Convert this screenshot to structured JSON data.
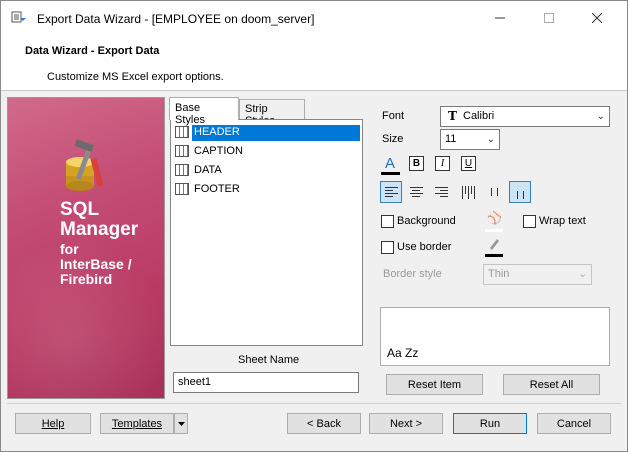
{
  "window": {
    "title": "Export Data Wizard - [EMPLOYEE on doom_server]"
  },
  "header": {
    "title": "Data Wizard - Export Data",
    "subtitle": "Customize MS Excel export options."
  },
  "banner": {
    "line1": "SQL",
    "line2": "Manager",
    "line3": "for",
    "line4": "InterBase /",
    "line5": "Firebird",
    "icon": "database-tools-icon"
  },
  "tabs": [
    {
      "label": "Base Styles",
      "active": true
    },
    {
      "label": "Strip Styles",
      "active": false
    }
  ],
  "styles_list": [
    {
      "label": "HEADER",
      "selected": true
    },
    {
      "label": "CAPTION",
      "selected": false
    },
    {
      "label": "DATA",
      "selected": false
    },
    {
      "label": "FOOTER",
      "selected": false
    }
  ],
  "sheet": {
    "label": "Sheet Name",
    "value": "sheet1"
  },
  "font": {
    "label": "Font",
    "value": "Calibri"
  },
  "size": {
    "label": "Size",
    "value": "11"
  },
  "format_buttons": {
    "bold": "B",
    "italic": "I",
    "underline": "U",
    "color_letter": "A"
  },
  "options": {
    "background": {
      "label": "Background",
      "checked": false
    },
    "wrap_text": {
      "label": "Wrap text",
      "checked": false
    },
    "use_border": {
      "label": "Use border",
      "checked": false
    }
  },
  "border_style": {
    "label": "Border style",
    "value": "Thin"
  },
  "preview": {
    "text": "Aa Zz"
  },
  "buttons": {
    "reset_item": "Reset Item",
    "reset_all": "Reset All",
    "help": "Help",
    "templates": "Templates",
    "back": "< Back",
    "next": "Next >",
    "run": "Run",
    "cancel": "Cancel"
  },
  "colors": {
    "selection": "#0078d7",
    "banner": "#c44d75",
    "accent_text": "#1e6dc7"
  }
}
